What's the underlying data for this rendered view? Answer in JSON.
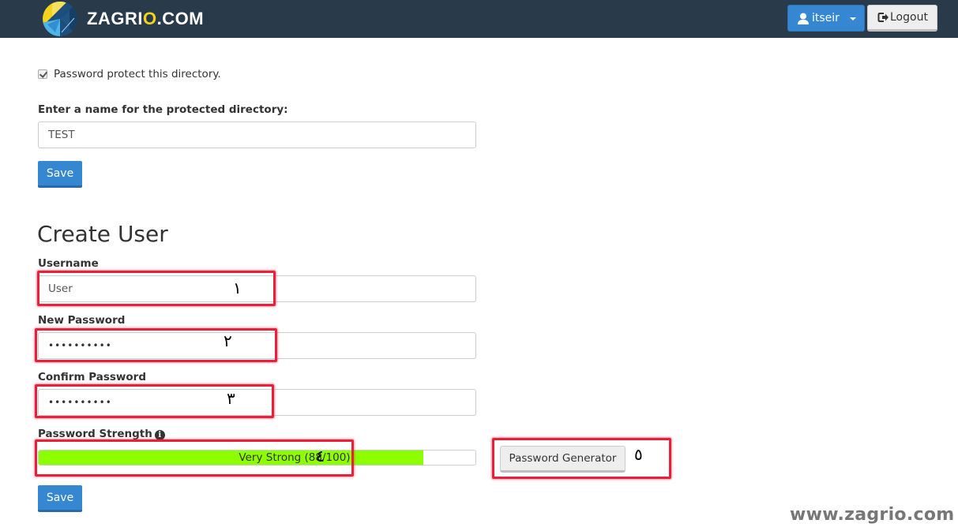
{
  "header": {
    "brand_prefix": "ZAGRI",
    "brand_o": "O",
    "brand_suffix": ".COM",
    "user_menu_label": "itseir",
    "logout_label": "Logout",
    "accent_color": "#3687d1",
    "bar_color": "#293a4a"
  },
  "directory": {
    "protect_checkbox_label": "Password protect this directory.",
    "protect_checked": true,
    "name_label": "Enter a name for the protected directory:",
    "name_value": "TEST",
    "save_label": "Save"
  },
  "create_user": {
    "title": "Create User",
    "username_label": "Username",
    "username_value": "User",
    "new_password_label": "New Password",
    "new_password_value": "••••••••••",
    "confirm_password_label": "Confirm Password",
    "confirm_password_value": "••••••••••",
    "strength_label": "Password Strength",
    "strength_text": "Very Strong (88/100)",
    "strength_score": 88,
    "strength_max": 100,
    "strength_color": "#8cff00",
    "generator_label": "Password Generator",
    "save_label": "Save"
  },
  "annotations": {
    "n1": "١",
    "n2": "٢",
    "n3": "٣",
    "n4": "٤",
    "n5": "٥",
    "color": "#e8203a"
  },
  "watermark": "www.zagrio.com"
}
